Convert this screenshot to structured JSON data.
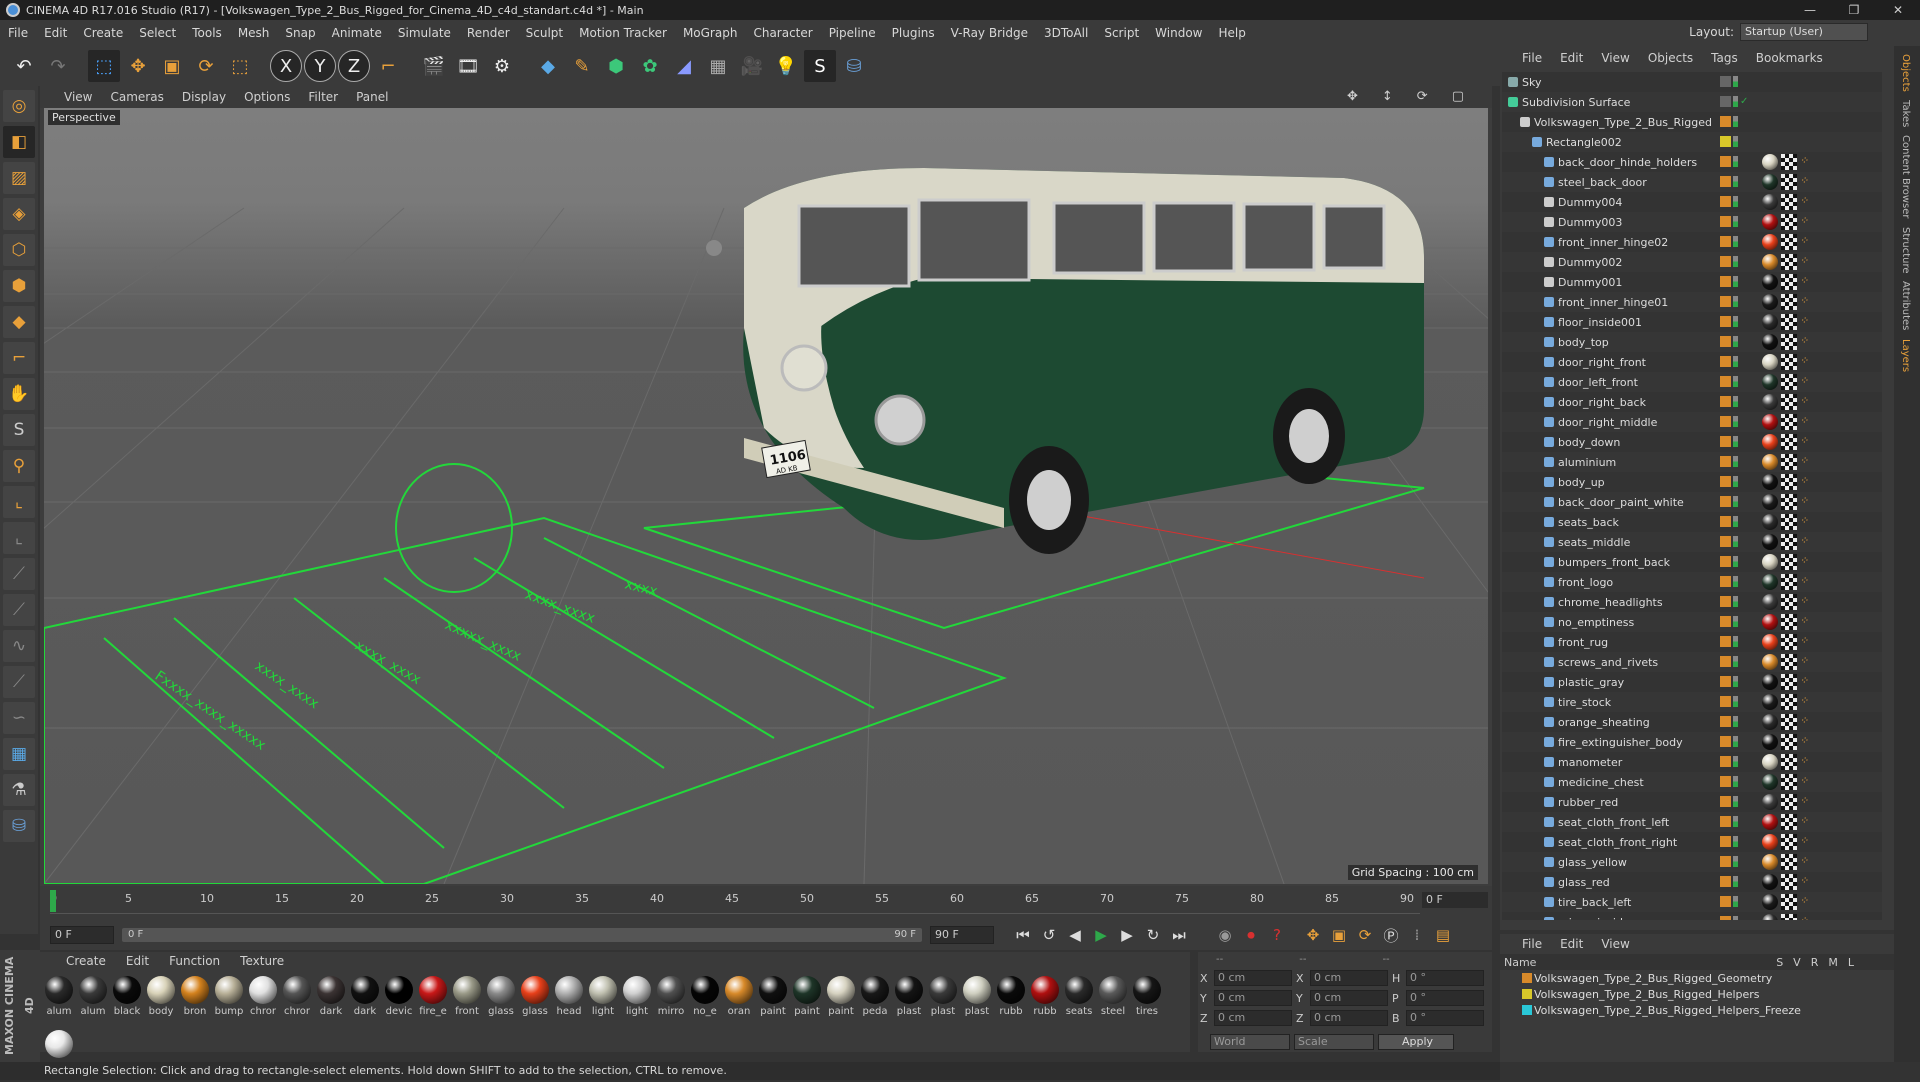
{
  "window": {
    "title": "CINEMA 4D R17.016 Studio (R17) - [Volkswagen_Type_2_Bus_Rigged_for_Cinema_4D_c4d_standart.c4d *] - Main",
    "controls": [
      "—",
      "❐",
      "✕"
    ]
  },
  "menubar": {
    "items": [
      "File",
      "Edit",
      "Create",
      "Select",
      "Tools",
      "Mesh",
      "Snap",
      "Animate",
      "Simulate",
      "Render",
      "Sculpt",
      "Motion Tracker",
      "MoGraph",
      "Character",
      "Pipeline",
      "Plugins",
      "V-Ray Bridge",
      "3DToAll",
      "Script",
      "Window",
      "Help"
    ],
    "layout_label": "Layout:",
    "layout_value": "Startup (User)"
  },
  "toolbar": {
    "axis_labels": [
      "X",
      "Y",
      "Z"
    ]
  },
  "viewport": {
    "menu": [
      "View",
      "Cameras",
      "Display",
      "Options",
      "Filter",
      "Panel"
    ],
    "camera_label": "Perspective",
    "grid_spacing": "Grid Spacing : 100 cm",
    "plate": "1106",
    "plate_sub": "AD KB"
  },
  "timeline": {
    "ticks": [
      "0",
      "5",
      "10",
      "15",
      "20",
      "25",
      "30",
      "35",
      "40",
      "45",
      "50",
      "55",
      "60",
      "65",
      "70",
      "75",
      "80",
      "85",
      "90"
    ],
    "current_frame": "0 F"
  },
  "transport": {
    "start_field": "0 F",
    "slider_start": "0 F",
    "slider_end": "90 F",
    "end_field": "90 F"
  },
  "material_manager": {
    "menu": [
      "Create",
      "Edit",
      "Function",
      "Texture"
    ],
    "materials": [
      {
        "label": "alum",
        "color": "#2a2a2a"
      },
      {
        "label": "alum",
        "color": "#3a3a3a"
      },
      {
        "label": "black",
        "color": "#0a0a0a"
      },
      {
        "label": "body",
        "color": "#d8d2b8"
      },
      {
        "label": "bron",
        "color": "#d4821e"
      },
      {
        "label": "bump",
        "color": "#b8b098"
      },
      {
        "label": "chror",
        "color": "#e0e0e0"
      },
      {
        "label": "chror",
        "color": "#555555"
      },
      {
        "label": "dark",
        "color": "#3b3333"
      },
      {
        "label": "dark",
        "color": "#111111"
      },
      {
        "label": "devic",
        "color": "#000000"
      },
      {
        "label": "fire_e",
        "color": "#c81818"
      },
      {
        "label": "front",
        "color": "#9a9a88"
      },
      {
        "label": "glass",
        "color": "#8a8a8a"
      },
      {
        "label": "glass",
        "color": "#e8401a"
      },
      {
        "label": "head",
        "color": "#b0b0b0"
      },
      {
        "label": "light",
        "color": "#c0c0b0"
      },
      {
        "label": "light",
        "color": "#d0d0d0"
      },
      {
        "label": "mirro",
        "color": "#505050"
      },
      {
        "label": "no_e",
        "color": "#050505"
      },
      {
        "label": "oran",
        "color": "#d88a2a"
      },
      {
        "label": "paint",
        "color": "#101010"
      },
      {
        "label": "paint",
        "color": "#1e3528"
      },
      {
        "label": "paint",
        "color": "#d6d2c0"
      },
      {
        "label": "peda",
        "color": "#181818"
      },
      {
        "label": "plast",
        "color": "#141414"
      },
      {
        "label": "plast",
        "color": "#3a3a3a"
      },
      {
        "label": "plast",
        "color": "#cfcfc0"
      },
      {
        "label": "rubb",
        "color": "#0a0a0a"
      },
      {
        "label": "rubb",
        "color": "#b01010"
      },
      {
        "label": "seats",
        "color": "#2a2a2a"
      },
      {
        "label": "steel",
        "color": "#5a5a5a"
      },
      {
        "label": "tires",
        "color": "#161616"
      },
      {
        "label": "",
        "color": "#e8e8e8"
      }
    ]
  },
  "coords": {
    "rows": [
      {
        "a": "X",
        "av": "0 cm",
        "b": "X",
        "bv": "0 cm",
        "c": "H",
        "cv": "0 °"
      },
      {
        "a": "Y",
        "av": "0 cm",
        "b": "Y",
        "bv": "0 cm",
        "c": "P",
        "cv": "0 °"
      },
      {
        "a": "Z",
        "av": "0 cm",
        "b": "Z",
        "bv": "0 cm",
        "c": "B",
        "cv": "0 °"
      }
    ],
    "header_a": "--",
    "header_b": "--",
    "header_c": "--",
    "world": "World",
    "scale": "Scale",
    "apply": "Apply"
  },
  "status": "Rectangle Selection: Click and drag to rectangle-select elements. Hold down SHIFT to add to the selection, CTRL to remove.",
  "maxon": "MAXON CINEMA 4D",
  "objects_panel": {
    "menu": [
      "File",
      "Edit",
      "View",
      "Objects",
      "Tags",
      "Bookmarks"
    ],
    "rows": [
      {
        "name": "Sky",
        "indent": 0,
        "icon": "#8aa"
      },
      {
        "name": "Subdivision Surface",
        "indent": 0,
        "icon": "#4c9"
      },
      {
        "name": "Volkswagen_Type_2_Bus_Rigged",
        "indent": 1,
        "icon": "#ccc"
      },
      {
        "name": "Rectangle002",
        "indent": 2,
        "icon": "#7ad"
      },
      {
        "name": "back_door_hinde_holders",
        "indent": 3,
        "icon": "#7ad"
      },
      {
        "name": "steel_back_door",
        "indent": 3,
        "icon": "#7ad"
      },
      {
        "name": "Dummy004",
        "indent": 3,
        "icon": "#ccc"
      },
      {
        "name": "Dummy003",
        "indent": 3,
        "icon": "#ccc"
      },
      {
        "name": "front_inner_hinge02",
        "indent": 3,
        "icon": "#7ad"
      },
      {
        "name": "Dummy002",
        "indent": 3,
        "icon": "#ccc"
      },
      {
        "name": "Dummy001",
        "indent": 3,
        "icon": "#ccc"
      },
      {
        "name": "front_inner_hinge01",
        "indent": 3,
        "icon": "#7ad"
      },
      {
        "name": "floor_inside001",
        "indent": 3,
        "icon": "#7ad"
      },
      {
        "name": "body_top",
        "indent": 3,
        "icon": "#7ad"
      },
      {
        "name": "door_right_front",
        "indent": 3,
        "icon": "#7ad"
      },
      {
        "name": "door_left_front",
        "indent": 3,
        "icon": "#7ad"
      },
      {
        "name": "door_right_back",
        "indent": 3,
        "icon": "#7ad"
      },
      {
        "name": "door_right_middle",
        "indent": 3,
        "icon": "#7ad"
      },
      {
        "name": "body_down",
        "indent": 3,
        "icon": "#7ad"
      },
      {
        "name": "aluminium",
        "indent": 3,
        "icon": "#7ad"
      },
      {
        "name": "body_up",
        "indent": 3,
        "icon": "#7ad"
      },
      {
        "name": "back_door_paint_white",
        "indent": 3,
        "icon": "#7ad"
      },
      {
        "name": "seats_back",
        "indent": 3,
        "icon": "#7ad"
      },
      {
        "name": "seats_middle",
        "indent": 3,
        "icon": "#7ad"
      },
      {
        "name": "bumpers_front_back",
        "indent": 3,
        "icon": "#7ad"
      },
      {
        "name": "front_logo",
        "indent": 3,
        "icon": "#7ad"
      },
      {
        "name": "chrome_headlights",
        "indent": 3,
        "icon": "#7ad"
      },
      {
        "name": "no_emptiness",
        "indent": 3,
        "icon": "#7ad"
      },
      {
        "name": "front_rug",
        "indent": 3,
        "icon": "#7ad"
      },
      {
        "name": "screws_and_rivets",
        "indent": 3,
        "icon": "#7ad"
      },
      {
        "name": "plastic_gray",
        "indent": 3,
        "icon": "#7ad"
      },
      {
        "name": "tire_stock",
        "indent": 3,
        "icon": "#7ad"
      },
      {
        "name": "orange_sheating",
        "indent": 3,
        "icon": "#7ad"
      },
      {
        "name": "fire_extinguisher_body",
        "indent": 3,
        "icon": "#7ad"
      },
      {
        "name": "manometer",
        "indent": 3,
        "icon": "#7ad"
      },
      {
        "name": "medicine_chest",
        "indent": 3,
        "icon": "#7ad"
      },
      {
        "name": "rubber_red",
        "indent": 3,
        "icon": "#7ad"
      },
      {
        "name": "seat_cloth_front_left",
        "indent": 3,
        "icon": "#7ad"
      },
      {
        "name": "seat_cloth_front_right",
        "indent": 3,
        "icon": "#7ad"
      },
      {
        "name": "glass_yellow",
        "indent": 3,
        "icon": "#7ad"
      },
      {
        "name": "glass_red",
        "indent": 3,
        "icon": "#7ad"
      },
      {
        "name": "tire_back_left",
        "indent": 3,
        "icon": "#7ad"
      },
      {
        "name": "mirror_inside",
        "indent": 3,
        "icon": "#7ad"
      }
    ]
  },
  "layers_panel": {
    "menu": [
      "File",
      "Edit",
      "View"
    ],
    "header_name": "Name",
    "header_cols": [
      "S",
      "V",
      "R",
      "M",
      "L"
    ],
    "rows": [
      {
        "name": "Volkswagen_Type_2_Bus_Rigged_Geometry",
        "color": "#d88a2a"
      },
      {
        "name": "Volkswagen_Type_2_Bus_Rigged_Helpers",
        "color": "#d8c82a"
      },
      {
        "name": "Volkswagen_Type_2_Bus_Rigged_Helpers_Freeze",
        "color": "#2ac8d8"
      }
    ]
  },
  "side_tabs": [
    "Objects",
    "Takes",
    "Content Browser",
    "Structure",
    "Attributes",
    "Layers"
  ]
}
